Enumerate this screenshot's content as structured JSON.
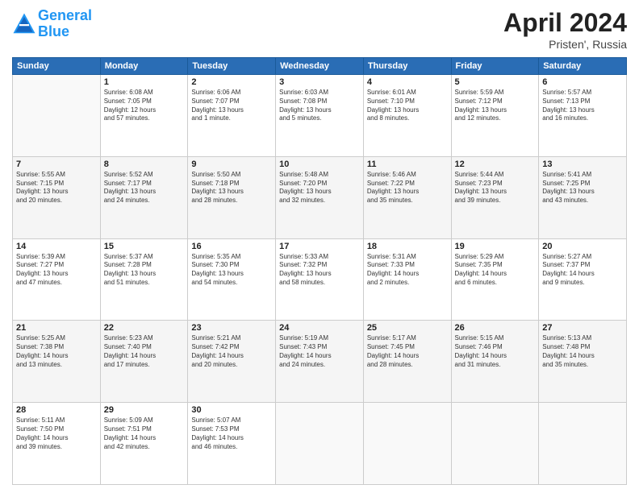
{
  "logo": {
    "line1": "General",
    "line2": "Blue"
  },
  "title": "April 2024",
  "location": "Pristen', Russia",
  "days_of_week": [
    "Sunday",
    "Monday",
    "Tuesday",
    "Wednesday",
    "Thursday",
    "Friday",
    "Saturday"
  ],
  "weeks": [
    [
      {
        "day": "",
        "info": ""
      },
      {
        "day": "1",
        "info": "Sunrise: 6:08 AM\nSunset: 7:05 PM\nDaylight: 12 hours\nand 57 minutes."
      },
      {
        "day": "2",
        "info": "Sunrise: 6:06 AM\nSunset: 7:07 PM\nDaylight: 13 hours\nand 1 minute."
      },
      {
        "day": "3",
        "info": "Sunrise: 6:03 AM\nSunset: 7:08 PM\nDaylight: 13 hours\nand 5 minutes."
      },
      {
        "day": "4",
        "info": "Sunrise: 6:01 AM\nSunset: 7:10 PM\nDaylight: 13 hours\nand 8 minutes."
      },
      {
        "day": "5",
        "info": "Sunrise: 5:59 AM\nSunset: 7:12 PM\nDaylight: 13 hours\nand 12 minutes."
      },
      {
        "day": "6",
        "info": "Sunrise: 5:57 AM\nSunset: 7:13 PM\nDaylight: 13 hours\nand 16 minutes."
      }
    ],
    [
      {
        "day": "7",
        "info": "Sunrise: 5:55 AM\nSunset: 7:15 PM\nDaylight: 13 hours\nand 20 minutes."
      },
      {
        "day": "8",
        "info": "Sunrise: 5:52 AM\nSunset: 7:17 PM\nDaylight: 13 hours\nand 24 minutes."
      },
      {
        "day": "9",
        "info": "Sunrise: 5:50 AM\nSunset: 7:18 PM\nDaylight: 13 hours\nand 28 minutes."
      },
      {
        "day": "10",
        "info": "Sunrise: 5:48 AM\nSunset: 7:20 PM\nDaylight: 13 hours\nand 32 minutes."
      },
      {
        "day": "11",
        "info": "Sunrise: 5:46 AM\nSunset: 7:22 PM\nDaylight: 13 hours\nand 35 minutes."
      },
      {
        "day": "12",
        "info": "Sunrise: 5:44 AM\nSunset: 7:23 PM\nDaylight: 13 hours\nand 39 minutes."
      },
      {
        "day": "13",
        "info": "Sunrise: 5:41 AM\nSunset: 7:25 PM\nDaylight: 13 hours\nand 43 minutes."
      }
    ],
    [
      {
        "day": "14",
        "info": "Sunrise: 5:39 AM\nSunset: 7:27 PM\nDaylight: 13 hours\nand 47 minutes."
      },
      {
        "day": "15",
        "info": "Sunrise: 5:37 AM\nSunset: 7:28 PM\nDaylight: 13 hours\nand 51 minutes."
      },
      {
        "day": "16",
        "info": "Sunrise: 5:35 AM\nSunset: 7:30 PM\nDaylight: 13 hours\nand 54 minutes."
      },
      {
        "day": "17",
        "info": "Sunrise: 5:33 AM\nSunset: 7:32 PM\nDaylight: 13 hours\nand 58 minutes."
      },
      {
        "day": "18",
        "info": "Sunrise: 5:31 AM\nSunset: 7:33 PM\nDaylight: 14 hours\nand 2 minutes."
      },
      {
        "day": "19",
        "info": "Sunrise: 5:29 AM\nSunset: 7:35 PM\nDaylight: 14 hours\nand 6 minutes."
      },
      {
        "day": "20",
        "info": "Sunrise: 5:27 AM\nSunset: 7:37 PM\nDaylight: 14 hours\nand 9 minutes."
      }
    ],
    [
      {
        "day": "21",
        "info": "Sunrise: 5:25 AM\nSunset: 7:38 PM\nDaylight: 14 hours\nand 13 minutes."
      },
      {
        "day": "22",
        "info": "Sunrise: 5:23 AM\nSunset: 7:40 PM\nDaylight: 14 hours\nand 17 minutes."
      },
      {
        "day": "23",
        "info": "Sunrise: 5:21 AM\nSunset: 7:42 PM\nDaylight: 14 hours\nand 20 minutes."
      },
      {
        "day": "24",
        "info": "Sunrise: 5:19 AM\nSunset: 7:43 PM\nDaylight: 14 hours\nand 24 minutes."
      },
      {
        "day": "25",
        "info": "Sunrise: 5:17 AM\nSunset: 7:45 PM\nDaylight: 14 hours\nand 28 minutes."
      },
      {
        "day": "26",
        "info": "Sunrise: 5:15 AM\nSunset: 7:46 PM\nDaylight: 14 hours\nand 31 minutes."
      },
      {
        "day": "27",
        "info": "Sunrise: 5:13 AM\nSunset: 7:48 PM\nDaylight: 14 hours\nand 35 minutes."
      }
    ],
    [
      {
        "day": "28",
        "info": "Sunrise: 5:11 AM\nSunset: 7:50 PM\nDaylight: 14 hours\nand 39 minutes."
      },
      {
        "day": "29",
        "info": "Sunrise: 5:09 AM\nSunset: 7:51 PM\nDaylight: 14 hours\nand 42 minutes."
      },
      {
        "day": "30",
        "info": "Sunrise: 5:07 AM\nSunset: 7:53 PM\nDaylight: 14 hours\nand 46 minutes."
      },
      {
        "day": "",
        "info": ""
      },
      {
        "day": "",
        "info": ""
      },
      {
        "day": "",
        "info": ""
      },
      {
        "day": "",
        "info": ""
      }
    ]
  ]
}
